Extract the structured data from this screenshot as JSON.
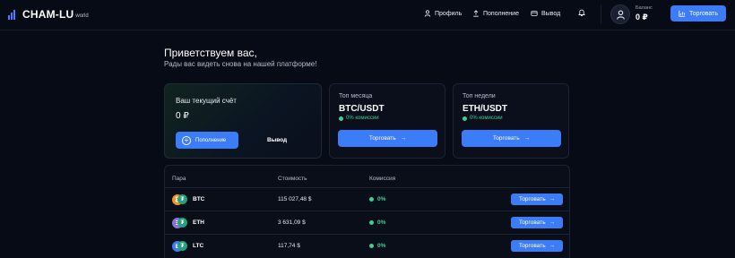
{
  "header": {
    "logo_text": "CHAM-LU",
    "logo_sub": "world",
    "nav": [
      {
        "label": "Профиль",
        "icon": "user-icon"
      },
      {
        "label": "Пополнение",
        "icon": "upload-icon"
      },
      {
        "label": "Вывод",
        "icon": "wallet-icon"
      }
    ],
    "balance_label": "Баланс",
    "balance_value": "0 ₽",
    "trade_label": "Торговать"
  },
  "greeting": {
    "title": "Приветствуем вас,",
    "subtitle": "Рады вас видеть снова на нашей платформе!"
  },
  "account_card": {
    "label": "Ваш текущий счёт",
    "value": "0 ₽",
    "topup_label": "Пополнение",
    "withdraw_label": "Вывод"
  },
  "month_card": {
    "title": "Топ месяца",
    "pair": "BTC/USDT",
    "commission": "0% комиссии",
    "button": "Торговать"
  },
  "week_card": {
    "title": "Топ недели",
    "pair": "ETH/USDT",
    "commission": "0% комиссии",
    "button": "Торговать"
  },
  "table": {
    "headers": [
      "Пара",
      "Стоимость",
      "Комиссия"
    ],
    "rows": [
      {
        "symbol": "BTC",
        "price": "115 027,48 $",
        "fee": "0%",
        "button": "Торговать",
        "color": "#f7931a",
        "glyph": "₿"
      },
      {
        "symbol": "ETH",
        "price": "3 631,09 $",
        "fee": "0%",
        "button": "Торговать",
        "color": "#8c6fe0",
        "glyph": "Ξ"
      },
      {
        "symbol": "LTC",
        "price": "117,74 $",
        "fee": "0%",
        "button": "Торговать",
        "color": "#3c7cf6",
        "glyph": "Ł"
      }
    ]
  },
  "colors": {
    "accent": "#3c7cf6",
    "success": "#3ecf8e",
    "background": "#070b16"
  }
}
